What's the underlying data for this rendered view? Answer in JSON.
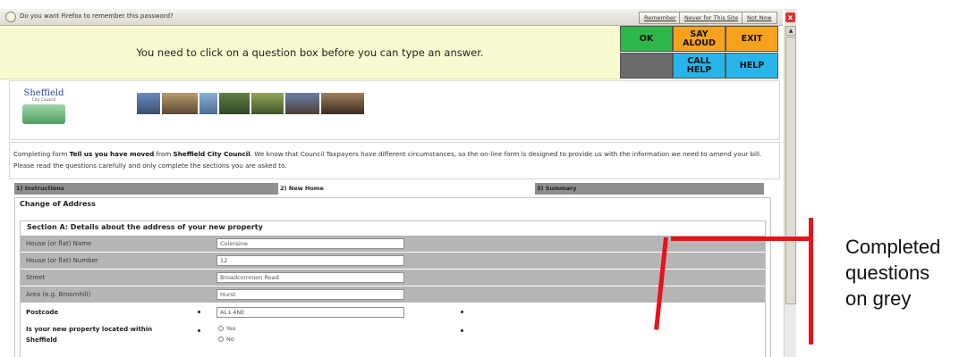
{
  "password_bar": {
    "message": "Do you want Firefox to remember this password?",
    "remember": "Remember",
    "never": "Never for This Site",
    "not_now": "Not Now",
    "close": "x"
  },
  "toolbar": {
    "notice": "You need to click on a question box before you can type an answer.",
    "ok": "OK",
    "say_aloud": "SAY ALOUD",
    "exit": "EXIT",
    "call_help": "CALL HELP",
    "help": "HELP"
  },
  "logo": {
    "name": "Sheffield",
    "sub": "City Council"
  },
  "intro": {
    "part1": "Completing form ",
    "form_name": "Tell us you have moved",
    "part2": " from ",
    "council": "Sheffield City Council",
    "part3": ". We know that Council Taxpayers have different circumstances, so the on-line form is designed to provide us with the information we need to amend your bill. Please read the questions carefully and only complete the sections you are asked to."
  },
  "steps": [
    "1) Instructions",
    "2) New Home",
    "3) Summary"
  ],
  "section": {
    "outer_legend": "Change of Address",
    "inner_legend": "Section A: Details about the address of your new property"
  },
  "fields": [
    {
      "label": "House (or flat) Name",
      "value": "Coleraine"
    },
    {
      "label": "House (or flat) Number",
      "value": "12"
    },
    {
      "label": "Street",
      "value": "Broadcommon Road"
    },
    {
      "label": "Area (e.g. Broomhill)",
      "value": "Hurst"
    }
  ],
  "postcode": {
    "label": "Postcode",
    "value": "AL1 4NE"
  },
  "located": {
    "label_line1": "Is your new property located within",
    "label_line2": "Sheffield",
    "options": [
      "Yes",
      "No"
    ]
  },
  "annotation": {
    "line1": "Completed",
    "line2": "questions",
    "line3": "on grey"
  },
  "colors": {
    "annotation": "#e8121a",
    "completed_row": "#b5b5b5",
    "ok_button": "#2fb84a",
    "orange_button": "#f6a21d",
    "blue_button": "#27b5e9"
  }
}
